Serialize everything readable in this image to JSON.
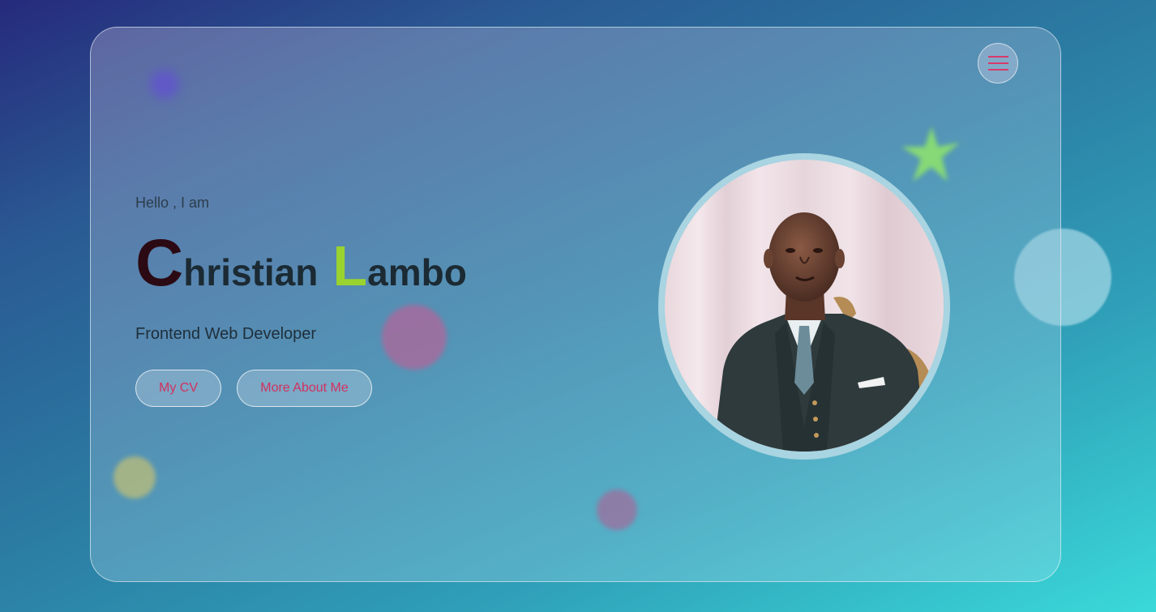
{
  "hero": {
    "greeting": "Hello , I am",
    "name_first_initial": "C",
    "name_first_rest": "hristian",
    "name_last_initial": "L",
    "name_last_rest": "ambo",
    "role": "Frontend Web Developer"
  },
  "buttons": {
    "cv_label": "My CV",
    "about_label": "More About Me"
  },
  "menu": {
    "icon": "hamburger-menu-icon"
  },
  "colors": {
    "accent_pink": "#d83a6b",
    "name_initial_dark": "#2b0a14",
    "name_initial_green": "#9ad22f",
    "background_start": "#262a7c",
    "background_end": "#3ad9d9"
  }
}
